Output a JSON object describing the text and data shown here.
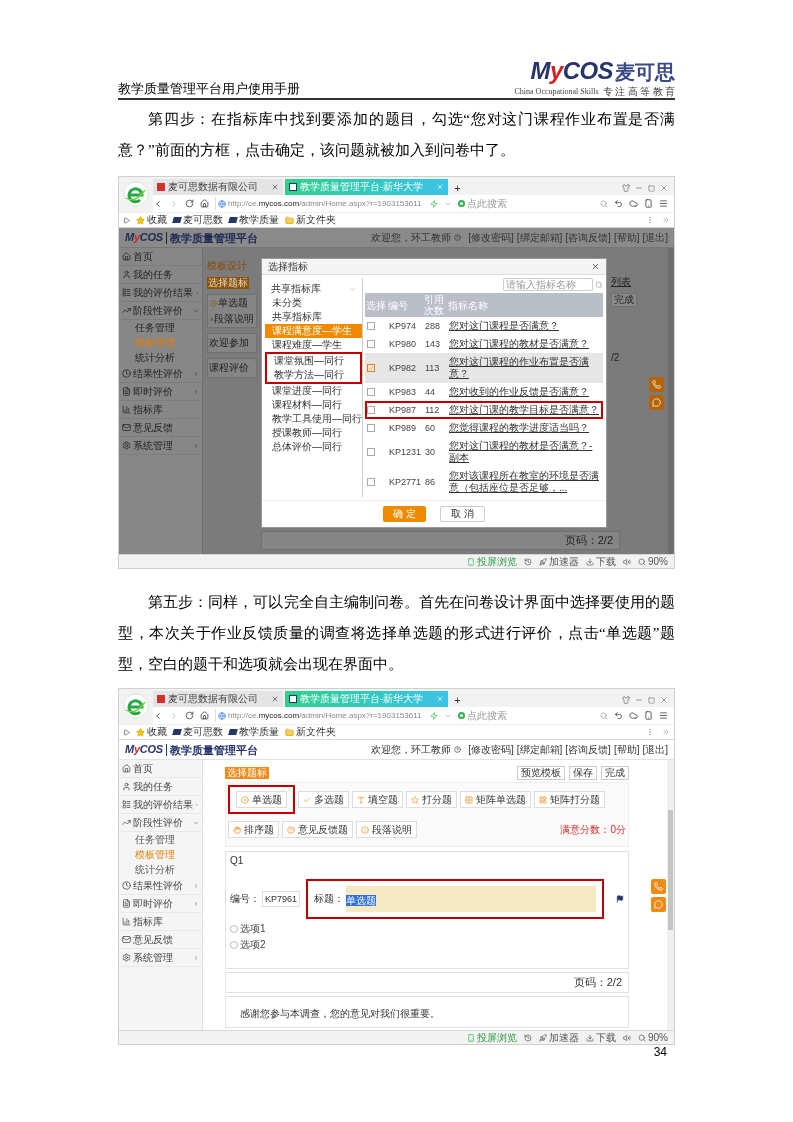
{
  "header": {
    "title": "教学质量管理平台用户使用手册",
    "logo": {
      "brand": "MyCOS",
      "name": "麦可思",
      "tagline_en": "China Occupational Skills",
      "tagline_cn": "专 注 高 等 教 育"
    }
  },
  "paragraphs": [
    "第四步：在指标库中找到要添加的题目，勾选“您对这门课程作业布置是否满意？”前面的方框，点击确定，该问题就被加入到问卷中了。",
    "第五步：同样，可以完全自主编制问卷。首先在问卷设计界面中选择要使用的题型，本次关于作业反馈质量的调查将选择单选题的形式进行评价，点击“单选题”题型，空白的题干和选项就会出现在界面中。"
  ],
  "screenshots": [
    {
      "kind": "dialog",
      "browser": {
        "tabs": [
          {
            "label": "麦可思数据有限公司",
            "selected": false
          },
          {
            "label": "教学质量管理平台-新华大学",
            "selected": true
          }
        ],
        "new_tab": "+",
        "url": "http://ce.**mycos.com**/admin/Home.aspx?r=1903153611",
        "search_placeholder": "点此搜索",
        "bookmarks": [
          {
            "label": "收藏",
            "kind": "star"
          },
          {
            "label": "麦可思数",
            "kind": "logo"
          },
          {
            "label": "教学质量",
            "kind": "logo"
          },
          {
            "label": "新文件夹",
            "kind": "folder"
          }
        ],
        "status_items": [
          {
            "label": "投屏浏览",
            "kind": "cast"
          },
          {
            "label": "加速器",
            "kind": "rocket"
          },
          {
            "label": "下载",
            "kind": "download"
          },
          {
            "label": "90%",
            "kind": "zoom"
          }
        ]
      },
      "app": {
        "brand": "MyCOS",
        "title": "教学质量管理平台",
        "greeting": "欢迎您，环工教师",
        "links": [
          "[修改密码]",
          "[绑定邮箱]",
          "[咨询反馈]",
          "[帮助]",
          "[退出]"
        ],
        "sidebar": [
          {
            "label": "首页",
            "kind": "link"
          },
          {
            "label": "我的任务",
            "kind": "link"
          },
          {
            "label": "我的评价结果",
            "kind": "group",
            "expanded": false
          },
          {
            "label": "阶段性评价",
            "kind": "group",
            "expanded": true,
            "children": [
              {
                "label": "任务管理",
                "selected": false
              },
              {
                "label": "模板管理",
                "selected": true
              },
              {
                "label": "统计分析",
                "selected": false
              }
            ]
          },
          {
            "label": "结果性评价",
            "kind": "group",
            "expanded": false
          },
          {
            "label": "即时评价",
            "kind": "group",
            "expanded": false
          },
          {
            "label": "指标库",
            "kind": "link"
          },
          {
            "label": "意见反馈",
            "kind": "link"
          },
          {
            "label": "系统管理",
            "kind": "group",
            "expanded": false
          }
        ]
      },
      "background": {
        "heading": "模板设计",
        "tag": "选择题标",
        "types": [
          "单选题",
          "段落说明"
        ],
        "texts": [
          "欢迎参加",
          "课程评价"
        ],
        "side_link": "列表",
        "finish": "完成",
        "pager_fragment": "/2",
        "pager": "页码：2/2"
      },
      "dialog": {
        "title": "选择指标",
        "tree": {
          "label": "共享指标库",
          "expanded": true,
          "children": [
            {
              "label": "未分类",
              "selected": false,
              "highlighted": false
            },
            {
              "label": "共享指标库",
              "selected": false,
              "highlighted": false
            },
            {
              "label": "课程满意度—学生",
              "selected": true,
              "highlighted": false
            },
            {
              "label": "课程难度—学生",
              "selected": false,
              "highlighted": false
            },
            {
              "label": "课堂氛围—同行",
              "selected": false,
              "highlighted": true
            },
            {
              "label": "教学方法—同行",
              "selected": false,
              "highlighted": true
            },
            {
              "label": "课堂进度—同行",
              "selected": false,
              "highlighted": false
            },
            {
              "label": "课程材料—同行",
              "selected": false,
              "highlighted": false
            },
            {
              "label": "教学工具使用—同行",
              "selected": false,
              "highlighted": false
            },
            {
              "label": "授课教师—同行",
              "selected": false,
              "highlighted": false
            },
            {
              "label": "总体评价—同行",
              "selected": false,
              "highlighted": false
            }
          ]
        },
        "search_placeholder": "请输入指标名称",
        "columns": [
          "选择",
          "编号",
          "引用次数",
          "指标名称"
        ],
        "rows": [
          {
            "code": "KP974",
            "count": "288",
            "name": "您对这门课程是否满意？",
            "checked": false,
            "highlighted": false
          },
          {
            "code": "KP980",
            "count": "143",
            "name": "您对这门课程的教材是否满意？",
            "checked": false,
            "highlighted": false
          },
          {
            "code": "KP982",
            "count": "113",
            "name": "您对这门课程的作业布置是否满意？",
            "checked": true,
            "highlighted": false
          },
          {
            "code": "KP983",
            "count": "44",
            "name": "您对收到的作业反馈是否满意？",
            "checked": false,
            "highlighted": false
          },
          {
            "code": "KP987",
            "count": "112",
            "name": "您对这门课的教学目标是否满意？",
            "checked": false,
            "highlighted": true
          },
          {
            "code": "KP989",
            "count": "60",
            "name": "您觉得课程的教学进度适当吗？",
            "checked": false,
            "highlighted": false
          },
          {
            "code": "KP1231",
            "count": "30",
            "name": "您对这门课程的教材是否满意？-副本",
            "checked": false,
            "highlighted": false
          },
          {
            "code": "KP2771",
            "count": "86",
            "name": "您对该课程所在教室的环境是否满意（包括座位是否足够，...",
            "checked": false,
            "highlighted": false
          }
        ],
        "confirm": "确 定",
        "cancel": "取 消"
      }
    },
    {
      "kind": "editor",
      "browser": {
        "tabs": [
          {
            "label": "麦可思数据有限公司",
            "selected": false
          },
          {
            "label": "教学质量管理平台-新华大学",
            "selected": true
          }
        ],
        "new_tab": "+",
        "url": "http://ce.**mycos.com**/admin/Home.aspx?r=1903153611",
        "search_placeholder": "点此搜索",
        "bookmarks": [
          {
            "label": "收藏",
            "kind": "star"
          },
          {
            "label": "麦可思数",
            "kind": "logo"
          },
          {
            "label": "教学质量",
            "kind": "logo"
          },
          {
            "label": "新文件夹",
            "kind": "folder"
          }
        ],
        "status_items": [
          {
            "label": "投屏浏览",
            "kind": "cast"
          },
          {
            "label": "加速器",
            "kind": "rocket"
          },
          {
            "label": "下载",
            "kind": "download"
          },
          {
            "label": "90%",
            "kind": "zoom"
          }
        ]
      },
      "app": {
        "brand": "MyCOS",
        "title": "教学质量管理平台",
        "greeting": "欢迎您，环工教师",
        "links": [
          "[修改密码]",
          "[绑定邮箱]",
          "[咨询反馈]",
          "[帮助]",
          "[退出]"
        ],
        "sidebar": [
          {
            "label": "首页",
            "kind": "link"
          },
          {
            "label": "我的任务",
            "kind": "link"
          },
          {
            "label": "我的评价结果",
            "kind": "group",
            "expanded": false
          },
          {
            "label": "阶段性评价",
            "kind": "group",
            "expanded": true,
            "children": [
              {
                "label": "任务管理",
                "selected": false
              },
              {
                "label": "模板管理",
                "selected": true
              },
              {
                "label": "统计分析",
                "selected": false
              }
            ]
          },
          {
            "label": "结果性评价",
            "kind": "group",
            "expanded": false
          },
          {
            "label": "即时评价",
            "kind": "group",
            "expanded": false
          },
          {
            "label": "指标库",
            "kind": "link"
          },
          {
            "label": "意见反馈",
            "kind": "link"
          },
          {
            "label": "系统管理",
            "kind": "group",
            "expanded": false
          }
        ]
      },
      "editor": {
        "tag": "选择题标",
        "actions": [
          "预览模板",
          "保存",
          "完成"
        ],
        "types": [
          {
            "label": "单选题",
            "highlighted": true
          },
          {
            "label": "多选题",
            "highlighted": false
          },
          {
            "label": "填空题",
            "highlighted": false
          },
          {
            "label": "打分题",
            "highlighted": false
          },
          {
            "label": "矩阵单选题",
            "highlighted": false
          },
          {
            "label": "矩阵打分题",
            "highlighted": false
          },
          {
            "label": "排序题",
            "highlighted": false
          },
          {
            "label": "意见反馈题",
            "highlighted": false
          },
          {
            "label": "段落说明",
            "highlighted": false
          }
        ],
        "score": "满意分数：0分",
        "question": {
          "number": "Q1",
          "code_label": "编号：",
          "code": "KP7961",
          "title_label": "标题：",
          "title": "单选题",
          "title_selected": true,
          "highlighted": true,
          "options": [
            {
              "label": "选项1",
              "selected": false
            },
            {
              "label": "选项2",
              "selected": false
            }
          ]
        },
        "pager": "页码：2/2",
        "footer": "感谢您参与本调查，您的意见对我们很重要。"
      }
    }
  ],
  "page_number": "34"
}
